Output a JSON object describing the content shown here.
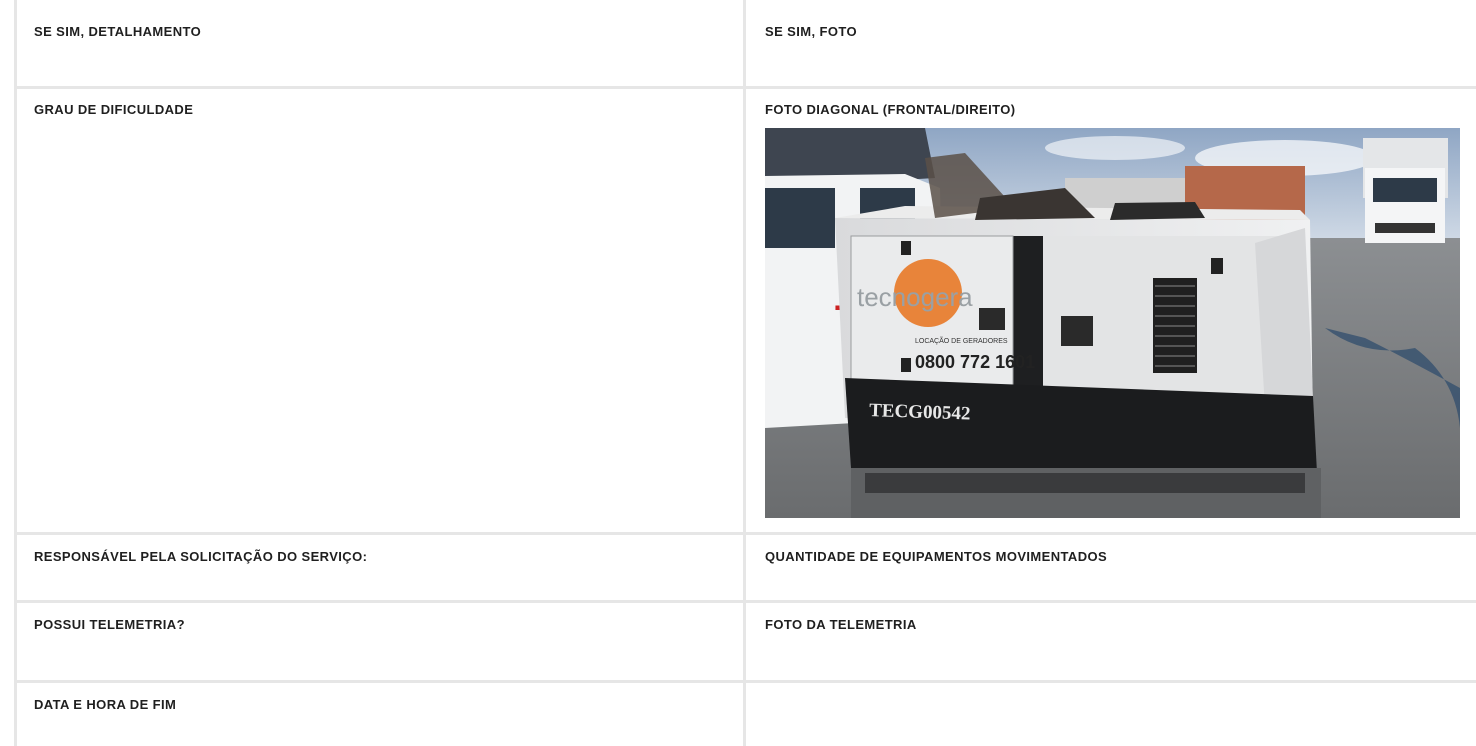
{
  "rows": [
    {
      "left": {
        "label": "SE SIM, DETALHAMENTO"
      },
      "right": {
        "label": "SE SIM, FOTO"
      }
    },
    {
      "left": {
        "label": "GRAU DE DIFICULDADE"
      },
      "right": {
        "label": "FOTO DIAGONAL (FRONTAL/DIREITO)"
      }
    },
    {
      "left": {
        "label": "RESPONSÁVEL PELA SOLICITAÇÃO DO SERVIÇO:"
      },
      "right": {
        "label": "QUANTIDADE DE EQUIPAMENTOS MOVIMENTADOS"
      }
    },
    {
      "left": {
        "label": "POSSUI TELEMETRIA?"
      },
      "right": {
        "label": "FOTO DA TELEMETRIA"
      }
    },
    {
      "left": {
        "label": "DATA E HORA DE FIM"
      },
      "right": {
        "label": ""
      }
    }
  ],
  "photo": {
    "brand": "tecnogera",
    "tagline": "LOCAÇÃO DE GERADORES",
    "phone": "0800 772 1601",
    "unit_id": "TECG00542"
  },
  "colors": {
    "divider": "#e6e6e6",
    "label": "#1f1f1f",
    "brand_orange": "#e8843a"
  }
}
